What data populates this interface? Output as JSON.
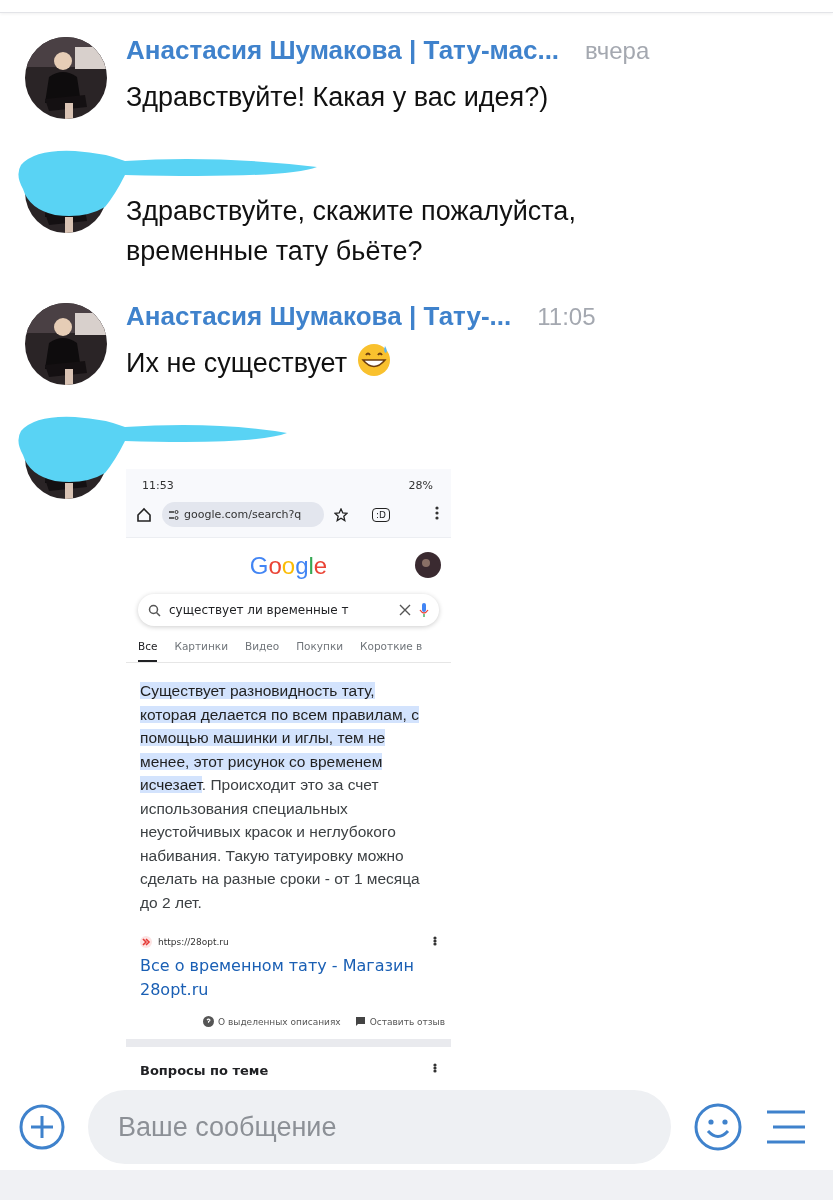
{
  "messages": [
    {
      "kind": "text",
      "author_hidden": false,
      "author": "Анастасия Шумакова | Тату-мас...",
      "time": "вчера",
      "text": "Здравствуйте! Какая у вас идея?)"
    },
    {
      "kind": "text",
      "author_hidden": true,
      "text": "Здравствуйте, скажите пожалуйста, временные тату бьёте?"
    },
    {
      "kind": "text",
      "author_hidden": false,
      "author": "Анастасия Шумакова | Тату-...",
      "time": "11:05",
      "text": "Их не существует",
      "emoji": true
    },
    {
      "kind": "screenshot",
      "author_hidden": true,
      "screenshot": {
        "status_time": "11:53",
        "battery": "28%",
        "url": "google.com/search?q",
        "tab_counter": ":D",
        "logo": "Google",
        "query": "существует ли временные т",
        "tabs": [
          {
            "label": "Все",
            "selected": true
          },
          {
            "label": "Картинки",
            "selected": false
          },
          {
            "label": "Видео",
            "selected": false
          },
          {
            "label": "Покупки",
            "selected": false
          },
          {
            "label": "Короткие в",
            "selected": false
          }
        ],
        "snippet_highlight": "Существует разновидность тату, которая делается по всем правилам, с помощью машинки и иглы, тем не менее, этот рисунок со временем исчезает",
        "snippet_rest": ". Происходит это за счет использования специальных неустойчивых красок и неглубокого набивания. Такую татуировку можно сделать на разные сроки - от 1 месяца до 2 лет.",
        "source_url": "https://28opt.ru",
        "result_title": "Все о временном тату - Магазин 28opt.ru",
        "about_link": "О выделенных описаниях",
        "feedback_link": "Оставить отзыв",
        "next_section": "Вопросы по теме"
      }
    }
  ],
  "composer": {
    "placeholder": "Ваше сообщение"
  }
}
